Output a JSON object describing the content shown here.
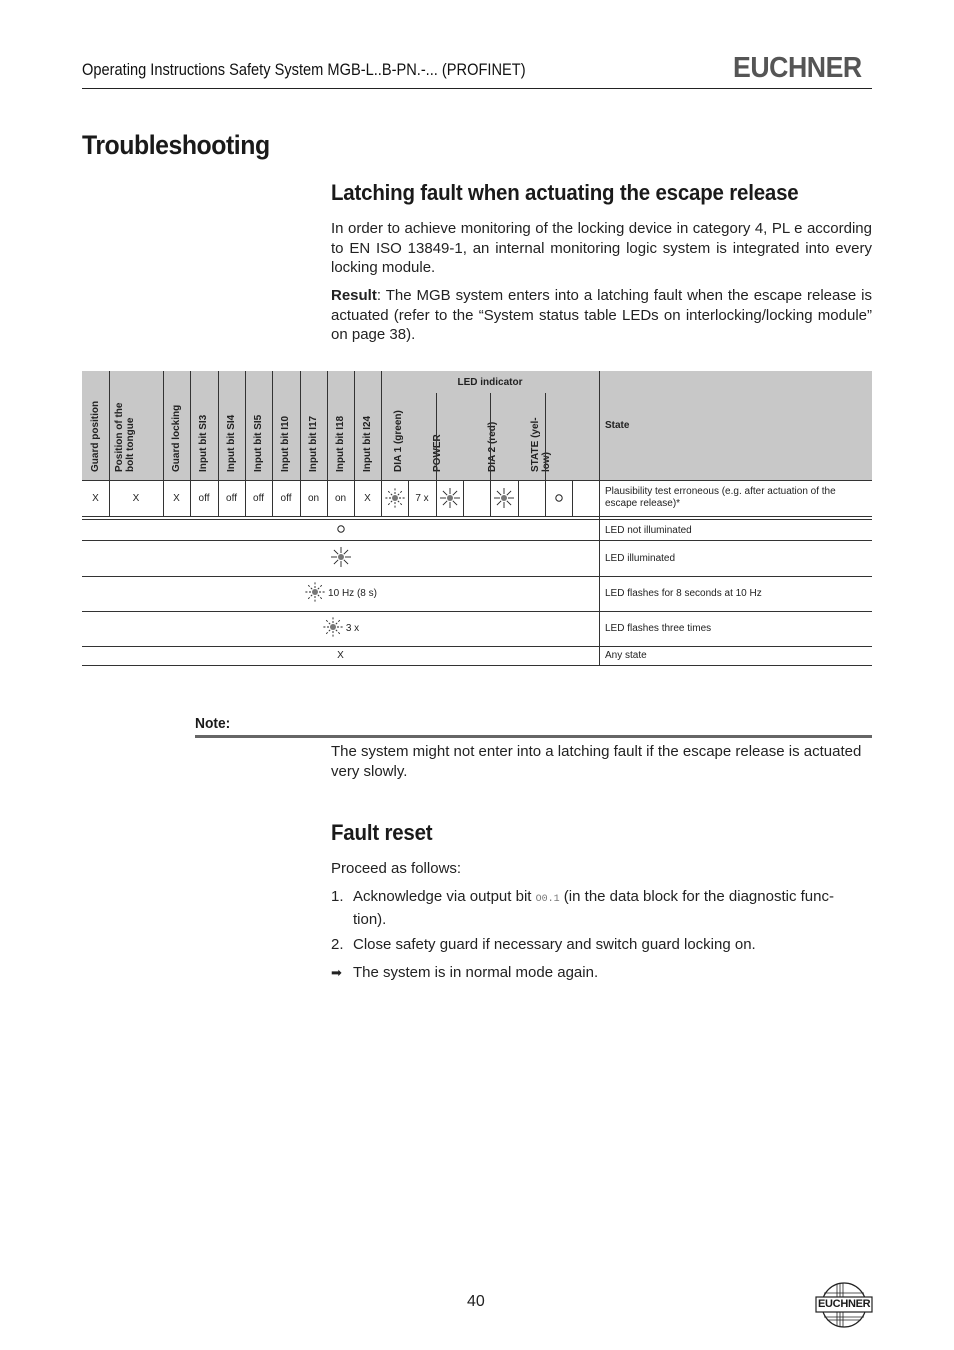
{
  "header": {
    "title": "Operating Instructions Safety System MGB-L..B-PN.-... (PROFINET)",
    "logo_text": "EUCHNER"
  },
  "page_title": "Troubleshooting",
  "section1": {
    "heading": "Latching fault when actuating the escape release",
    "para1": "In order to achieve monitoring of the locking device in category 4, PL e according to EN ISO 13849-1, an internal monitoring logic system is integrated into every locking module.",
    "result_label": "Result",
    "result_text": ": The MGB system enters into a latching fault when the escape release is actuated (refer to the “System status table LEDs on interlocking/locking module” on page 38)."
  },
  "table": {
    "group_header": "LED indicator",
    "columns": [
      "Guard position",
      "Position of the bolt tongue",
      "Guard locking",
      "Input bit SI3",
      "Input bit SI4",
      "Input bit SI5",
      "Input bit I10",
      "Input bit I17",
      "Input bit I18",
      "Input bit I24",
      "DIA 1 (green)",
      "POWER",
      "DIA 2 (red)",
      "STATE (yel-low)",
      "State"
    ],
    "column_lines": {
      "pos_bolt": [
        "Position of the",
        "bolt tongue"
      ],
      "state_led": [
        "STATE (yel-",
        "low)"
      ]
    },
    "row": {
      "guard_position": "X",
      "bolt_tongue": "X",
      "guard_locking": "X",
      "si3": "off",
      "si4": "off",
      "si5": "off",
      "i10": "off",
      "i17": "on",
      "i18": "on",
      "i24": "X",
      "dia1_icon": "led-flashing-icon",
      "dia1_count": "7 x",
      "power_icon": "led-illuminated-icon",
      "dia2_icon": "led-illuminated-icon",
      "state_led_icon": "led-off-icon",
      "state": "Plausibility test erroneous (e.g. after actuation of the escape release)*"
    },
    "legend": [
      {
        "icon": "led-off-icon",
        "symbol": "○",
        "label": "",
        "description": "LED not illuminated"
      },
      {
        "icon": "led-illuminated-icon",
        "symbol": "",
        "label": "",
        "description": "LED illuminated"
      },
      {
        "icon": "led-flashing-icon",
        "symbol": "",
        "label": "10 Hz (8 s)",
        "description": "LED flashes for 8 seconds at 10 Hz"
      },
      {
        "icon": "led-flashing-icon",
        "symbol": "",
        "label": "3 x",
        "description": "LED flashes three times"
      },
      {
        "icon": "",
        "symbol": "X",
        "label": "",
        "description": "Any state"
      }
    ]
  },
  "note": {
    "label": "Note:",
    "text": "The system might not enter into a latching fault if the escape release is actuated very slowly."
  },
  "section2": {
    "heading": "Fault reset",
    "intro": "Proceed as follows:",
    "steps": [
      {
        "num": "1.",
        "before": "Acknowledge via output bit ",
        "code": "O0.1",
        "after": " (in the data block for the diagnostic func-tion)."
      },
      {
        "num": "2.",
        "text": "Close safety guard if necessary and switch guard locking on."
      }
    ],
    "result_icon": "arrow-right-icon",
    "result": "The system is in normal mode again."
  },
  "footer": {
    "page_number": "40",
    "logo_text": "EUCHNER"
  }
}
